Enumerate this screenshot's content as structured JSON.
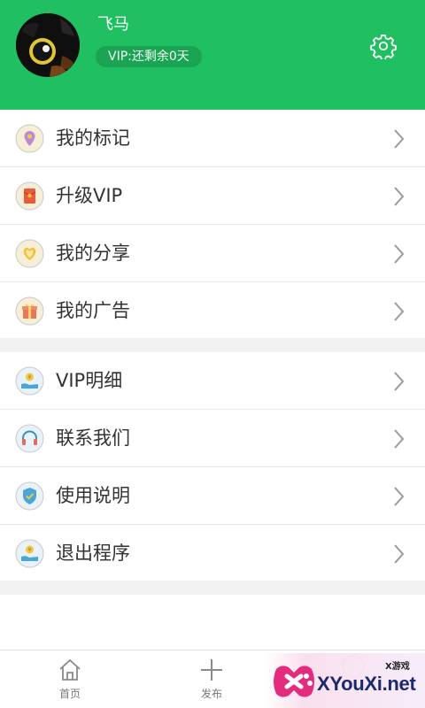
{
  "profile": {
    "username": "飞马",
    "vip_status": "VIP:还剩余0天"
  },
  "menu_group_1": [
    {
      "label": "我的标记",
      "icon": "location-pin-icon"
    },
    {
      "label": "升级VIP",
      "icon": "red-envelope-icon"
    },
    {
      "label": "我的分享",
      "icon": "heart-icon"
    },
    {
      "label": "我的广告",
      "icon": "gift-box-icon"
    }
  ],
  "menu_group_2": [
    {
      "label": "VIP明细",
      "icon": "coin-hand-icon"
    },
    {
      "label": "联系我们",
      "icon": "headphones-icon"
    },
    {
      "label": "使用说明",
      "icon": "shield-check-icon"
    },
    {
      "label": "退出程序",
      "icon": "coin-hand-icon"
    }
  ],
  "bottom_nav": {
    "home": "首页",
    "post": "发布"
  },
  "watermark": {
    "brand": "XYouXi.net",
    "tag": "X游戏"
  },
  "colors": {
    "header_green": "#1fbf62",
    "divider": "#e6e6e6",
    "section_gap": "#f2f2f2"
  }
}
